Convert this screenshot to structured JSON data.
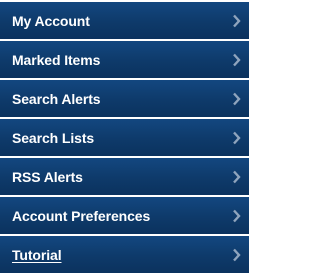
{
  "menu": {
    "items": [
      {
        "label": "My Account",
        "icon": "chevron-right-icon"
      },
      {
        "label": "Marked Items",
        "icon": "chevron-right-icon"
      },
      {
        "label": "Search Alerts",
        "icon": "chevron-right-icon"
      },
      {
        "label": "Search Lists",
        "icon": "chevron-right-icon"
      },
      {
        "label": "RSS Alerts",
        "icon": "chevron-right-icon"
      },
      {
        "label": "Account Preferences",
        "icon": "chevron-right-icon"
      },
      {
        "label": "Tutorial",
        "icon": "chevron-right-icon"
      }
    ]
  },
  "colors": {
    "item_background": "#0f3c6e",
    "item_text": "#ffffff",
    "chevron": "#8fa4bd",
    "separator": "#ffffff"
  }
}
